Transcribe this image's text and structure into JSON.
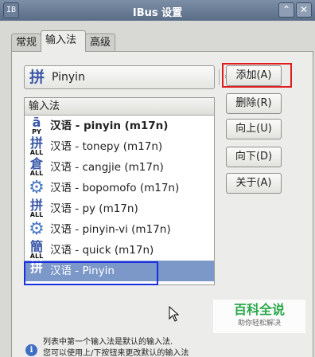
{
  "window": {
    "title": "IBus 设置",
    "app_icon": "ibus-icon",
    "minimize": "⌃",
    "close": "✕"
  },
  "tabs": [
    {
      "label": "常规"
    },
    {
      "label": "输入法"
    },
    {
      "label": "高级"
    }
  ],
  "active_tab": "输入法",
  "combo": {
    "icon_glyph": "拼",
    "value": "Pinyin"
  },
  "list": {
    "header": "输入法",
    "items": [
      {
        "label": "汉语 - pinyin (m17n)",
        "glyph": "ā",
        "sub": "PY",
        "icon": "pinyin-py-icon"
      },
      {
        "label": "汉语 - tonepy (m17n)",
        "glyph": "拼",
        "sub": "ALL",
        "icon": "tonepy-icon"
      },
      {
        "label": "汉语 - cangjie (m17n)",
        "glyph": "倉",
        "sub": "ALL",
        "icon": "cangjie-icon"
      },
      {
        "label": "汉语 - bopomofo (m17n)",
        "glyph": "⚙",
        "sub": "",
        "icon": "gear-icon"
      },
      {
        "label": "汉语 - py (m17n)",
        "glyph": "拼",
        "sub": "ALL",
        "icon": "py-icon"
      },
      {
        "label": "汉语 - pinyin-vi (m17n)",
        "glyph": "⚙",
        "sub": "",
        "icon": "gear-icon"
      },
      {
        "label": "汉语 - quick (m17n)",
        "glyph": "簡",
        "sub": "ALL",
        "icon": "quick-icon"
      },
      {
        "label": "汉语 - Pinyin",
        "glyph": "拼",
        "sub": "",
        "icon": "pinyin-icon"
      }
    ]
  },
  "buttons": {
    "add": "添加(A)",
    "remove": "删除(R)",
    "up": "向上(U)",
    "down": "向下(D)",
    "about": "关于(A)"
  },
  "info": {
    "line1": "列表中第一个输入法是默认的输入法.",
    "line2": "您可以使用上/下按钮来更改默认的输入法"
  },
  "watermark": {
    "main": "百科全说",
    "sub": "助你轻松解决"
  },
  "colors": {
    "selection": "#7c98c9",
    "highlight_red": "#e11c1c",
    "highlight_blue": "#1a2fe0"
  }
}
